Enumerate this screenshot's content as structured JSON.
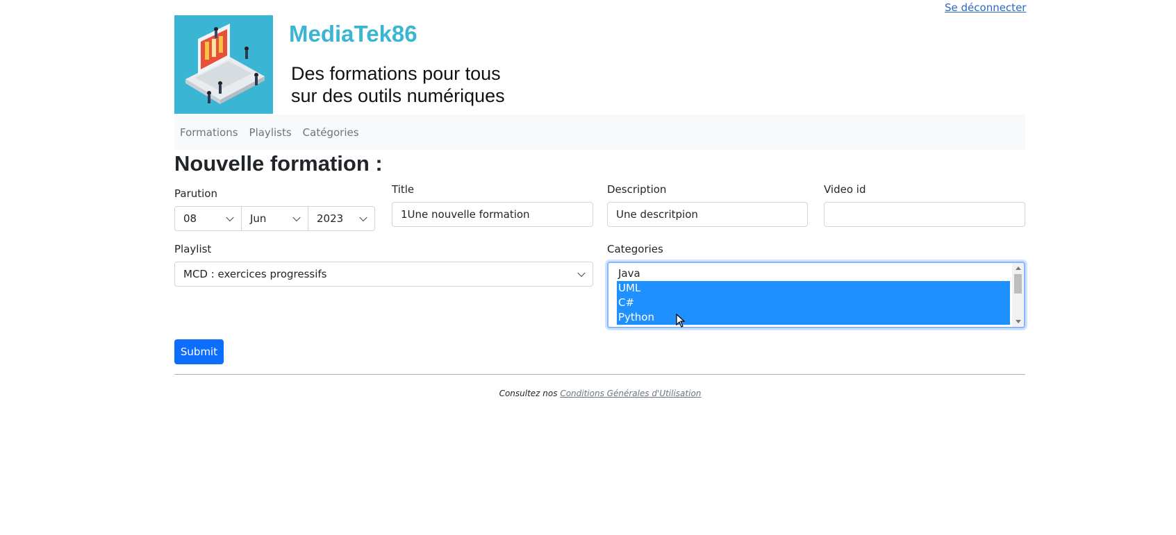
{
  "header": {
    "logout_label": "Se déconnecter",
    "site_title": "MediaTek86",
    "tagline_line1": "Des formations pour tous",
    "tagline_line2": "sur des outils numériques"
  },
  "nav": {
    "items": [
      "Formations",
      "Playlists",
      "Catégories"
    ]
  },
  "page": {
    "heading": "Nouvelle formation :"
  },
  "form": {
    "parution_label": "Parution",
    "parution_day": "08",
    "parution_month": "Jun",
    "parution_year": "2023",
    "title_label": "Title",
    "title_value": "1Une nouvelle formation",
    "description_label": "Description",
    "description_value": "Une descritpion",
    "videoid_label": "Video id",
    "videoid_value": "",
    "playlist_label": "Playlist",
    "playlist_value": "MCD : exercices progressifs",
    "categories_label": "Categories",
    "categories_options": [
      {
        "label": "Java",
        "selected": false
      },
      {
        "label": "UML",
        "selected": true
      },
      {
        "label": "C#",
        "selected": true
      },
      {
        "label": "Python",
        "selected": true
      }
    ],
    "submit_label": "Submit"
  },
  "footer": {
    "prefix": "Consultez nos",
    "link": "Conditions Générales d'Utilisation"
  },
  "colors": {
    "brand": "#3ab5d3",
    "primary": "#0d6efd",
    "selection": "#1e90ff"
  }
}
